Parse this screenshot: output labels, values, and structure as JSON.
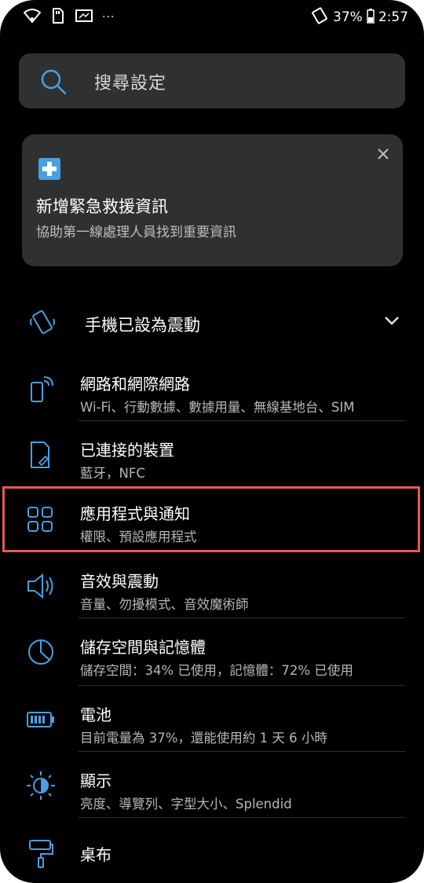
{
  "status_bar": {
    "battery": "37%",
    "time": "2:57",
    "icons": [
      "wifi-icon",
      "sd-card-icon",
      "screen-icon",
      "more-notifications-icon",
      "vibrate-icon",
      "battery-icon"
    ],
    "more": "···"
  },
  "search": {
    "placeholder": "搜尋設定"
  },
  "suggestion": {
    "title": "新增緊急救援資訊",
    "subtitle": "協助第一線處理人員找到重要資訊"
  },
  "sound_mode": {
    "label": "手機已設為震動"
  },
  "settings": [
    {
      "title": "網路和網際網路",
      "subtitle": "Wi-Fi、行動數據、數據用量、無線基地台、SIM",
      "icon": "network-icon"
    },
    {
      "title": "已連接的裝置",
      "subtitle": "藍牙，NFC",
      "icon": "connected-devices-icon"
    },
    {
      "title": "應用程式與通知",
      "subtitle": "權限、預設應用程式",
      "icon": "apps-icon"
    },
    {
      "title": "音效與震動",
      "subtitle": "音量、勿擾模式、音效魔術師",
      "icon": "sound-icon"
    },
    {
      "title": "儲存空間與記憶體",
      "subtitle": "儲存空間：34% 已使用，記憶體：72% 已使用",
      "icon": "storage-icon"
    },
    {
      "title": "電池",
      "subtitle": "目前電量為 37%，還能使用約 1 天 6 小時",
      "icon": "battery-icon"
    },
    {
      "title": "顯示",
      "subtitle": "亮度、導覽列、字型大小、Splendid",
      "icon": "display-icon"
    },
    {
      "title": "桌布",
      "subtitle": "",
      "icon": "wallpaper-icon"
    }
  ],
  "colors": {
    "accent": "#4a9fe0",
    "highlight": "#e85a50",
    "surface": "#2f3032"
  }
}
